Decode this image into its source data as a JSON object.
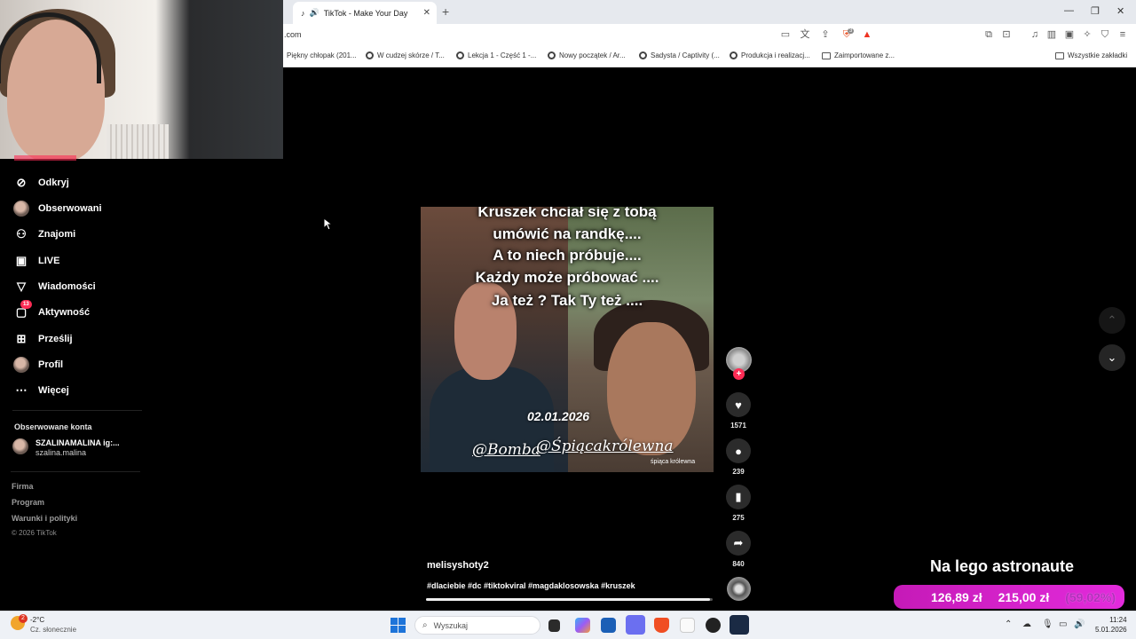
{
  "browser": {
    "tab_title": "TikTok - Make Your Day",
    "url_fragment": ".com",
    "bookmarks": [
      "Piękny chłopak (201...",
      "W cudzej skórze / T...",
      "Lekcja 1 - Część 1 -...",
      "Nowy początek / Ar...",
      "Sadysta / Captivity (...",
      "Produkcja i realizacj...",
      "Zaimportowane z..."
    ],
    "all_bookmarks": "Wszystkie zakładki",
    "shield_badge": "3"
  },
  "sidebar": {
    "items": [
      {
        "label": "Odkryj",
        "icon": "compass-icon"
      },
      {
        "label": "Obserwowani",
        "icon": "avatar"
      },
      {
        "label": "Znajomi",
        "icon": "friends-icon"
      },
      {
        "label": "LIVE",
        "icon": "live-icon"
      },
      {
        "label": "Wiadomości",
        "icon": "send-icon"
      },
      {
        "label": "Aktywność",
        "icon": "activity-icon",
        "badge": "13"
      },
      {
        "label": "Prześlij",
        "icon": "plus-square-icon"
      },
      {
        "label": "Profil",
        "icon": "avatar"
      },
      {
        "label": "Więcej",
        "icon": "more-icon"
      }
    ],
    "followed_header": "Obserwowane konta",
    "followed": {
      "name": "SZALINAMALINA ig:...",
      "handle": "szalina.malina"
    },
    "footer": [
      "Firma",
      "Program",
      "Warunki i polityki"
    ],
    "copyright": "© 2026 TikTok"
  },
  "video": {
    "captions": [
      "Kruszek chciał się z tobą",
      "umówić na randkę....",
      "A to niech próbuje....",
      "Każdy może próbować ....",
      "Ja też ? Tak Ty też ...."
    ],
    "date": "02.01.2026",
    "handle_left": "@Bomba",
    "handle_right": "@Śpiącakrólewna",
    "watermark": "śpiąca królewna",
    "author": "melisyshoty2",
    "hashtags": "#dlaciebie #dc #tiktokviral #magdaklosowska #kruszek",
    "progress_fraction": 0.99
  },
  "actions": {
    "likes": "1571",
    "comments": "239",
    "saves": "275",
    "shares": "840"
  },
  "overlay": {
    "title": "Na lego astronaute",
    "current": "126,89 zł",
    "goal": "215,00 zł",
    "percent": "(59,02%)"
  },
  "taskbar": {
    "temperature": "-2°C",
    "weather": "Cz. słonecznie",
    "weather_badge": "2",
    "search_placeholder": "Wyszukaj",
    "time": "11:24",
    "date": "5.01.2026"
  }
}
